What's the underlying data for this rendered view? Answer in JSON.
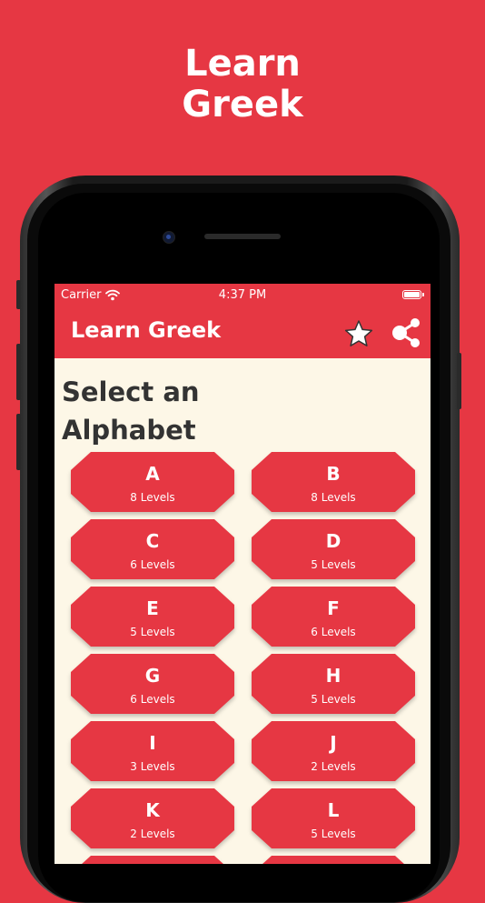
{
  "promo": {
    "line1": "Learn",
    "line2": "Greek"
  },
  "status_bar": {
    "carrier": "Carrier",
    "time": "4:37 PM"
  },
  "header": {
    "title": "Learn Greek",
    "icons": [
      "star-icon",
      "share-icon"
    ]
  },
  "page": {
    "title": "Select an Alphabet"
  },
  "colors": {
    "accent": "#e63743",
    "background": "#fdf7e7",
    "text": "#333333"
  },
  "alphabets": [
    {
      "letter": "A",
      "levels": "8 Levels"
    },
    {
      "letter": "B",
      "levels": "8 Levels"
    },
    {
      "letter": "C",
      "levels": "6 Levels"
    },
    {
      "letter": "D",
      "levels": "5 Levels"
    },
    {
      "letter": "E",
      "levels": "5 Levels"
    },
    {
      "letter": "F",
      "levels": "6 Levels"
    },
    {
      "letter": "G",
      "levels": "6 Levels"
    },
    {
      "letter": "H",
      "levels": "5 Levels"
    },
    {
      "letter": "I",
      "levels": "3 Levels"
    },
    {
      "letter": "J",
      "levels": "2 Levels"
    },
    {
      "letter": "K",
      "levels": "2 Levels"
    },
    {
      "letter": "L",
      "levels": "5 Levels"
    }
  ]
}
